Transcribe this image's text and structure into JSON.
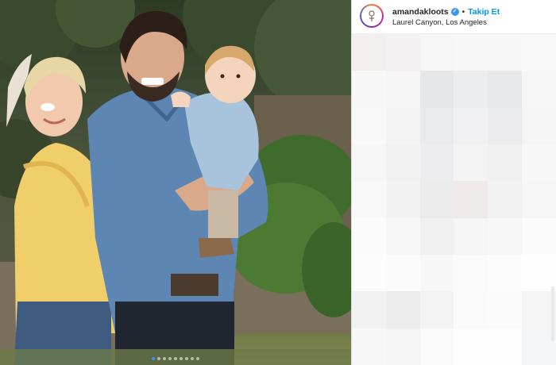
{
  "post": {
    "username": "amandakloots",
    "separator": "•",
    "follow_label": "Takip Et",
    "location": "Laurel Canyon, Los Angeles",
    "carousel": {
      "total_images": 9,
      "current_index": 1
    }
  },
  "colors": {
    "accent": "#0095f6",
    "verified": "#3897f0",
    "border": "#dbdbdb"
  },
  "icons": {
    "verified": "verified-badge-icon",
    "avatar": "profile-avatar"
  },
  "comments_area": {
    "pixelated": true,
    "tiles": [
      "#f2eeee",
      "#f3f1f1",
      "#f6f6f6",
      "#f7f7f7",
      "#f7f7f7",
      "#f8f8f8",
      "#f7f7f7",
      "#f5f5f5",
      "#e6e7e9",
      "#ecedef",
      "#e8e9eb",
      "#f6f6f6",
      "#f8f8f8",
      "#f3f3f3",
      "#e9eaec",
      "#f0f0f2",
      "#ebebed",
      "#f5f5f5",
      "#f6f6f6",
      "#f1f1f1",
      "#ececee",
      "#f3f3f3",
      "#f0f0f0",
      "#f7f7f7",
      "#f8f8f8",
      "#f2f2f2",
      "#ebebeb",
      "#eeeaea",
      "#f1f1f1",
      "#f6f6f6",
      "#fbfbfb",
      "#f6f6f6",
      "#f0f0f0",
      "#f5f5f5",
      "#f7f7f7",
      "#fbfbfb",
      "#fcfcfc",
      "#fbfbfb",
      "#f7f7f7",
      "#fafafa",
      "#fcfcfc",
      "#fdfdfd",
      "#f1f1f1",
      "#ececec",
      "#f3f3f3",
      "#fafafa",
      "#fbfbfb",
      "#f5f5f5",
      "#f7f7f7",
      "#f5f5f5",
      "#fafafa",
      "#fdfdfd",
      "#fdfdfd",
      "#f3f6f9"
    ]
  }
}
